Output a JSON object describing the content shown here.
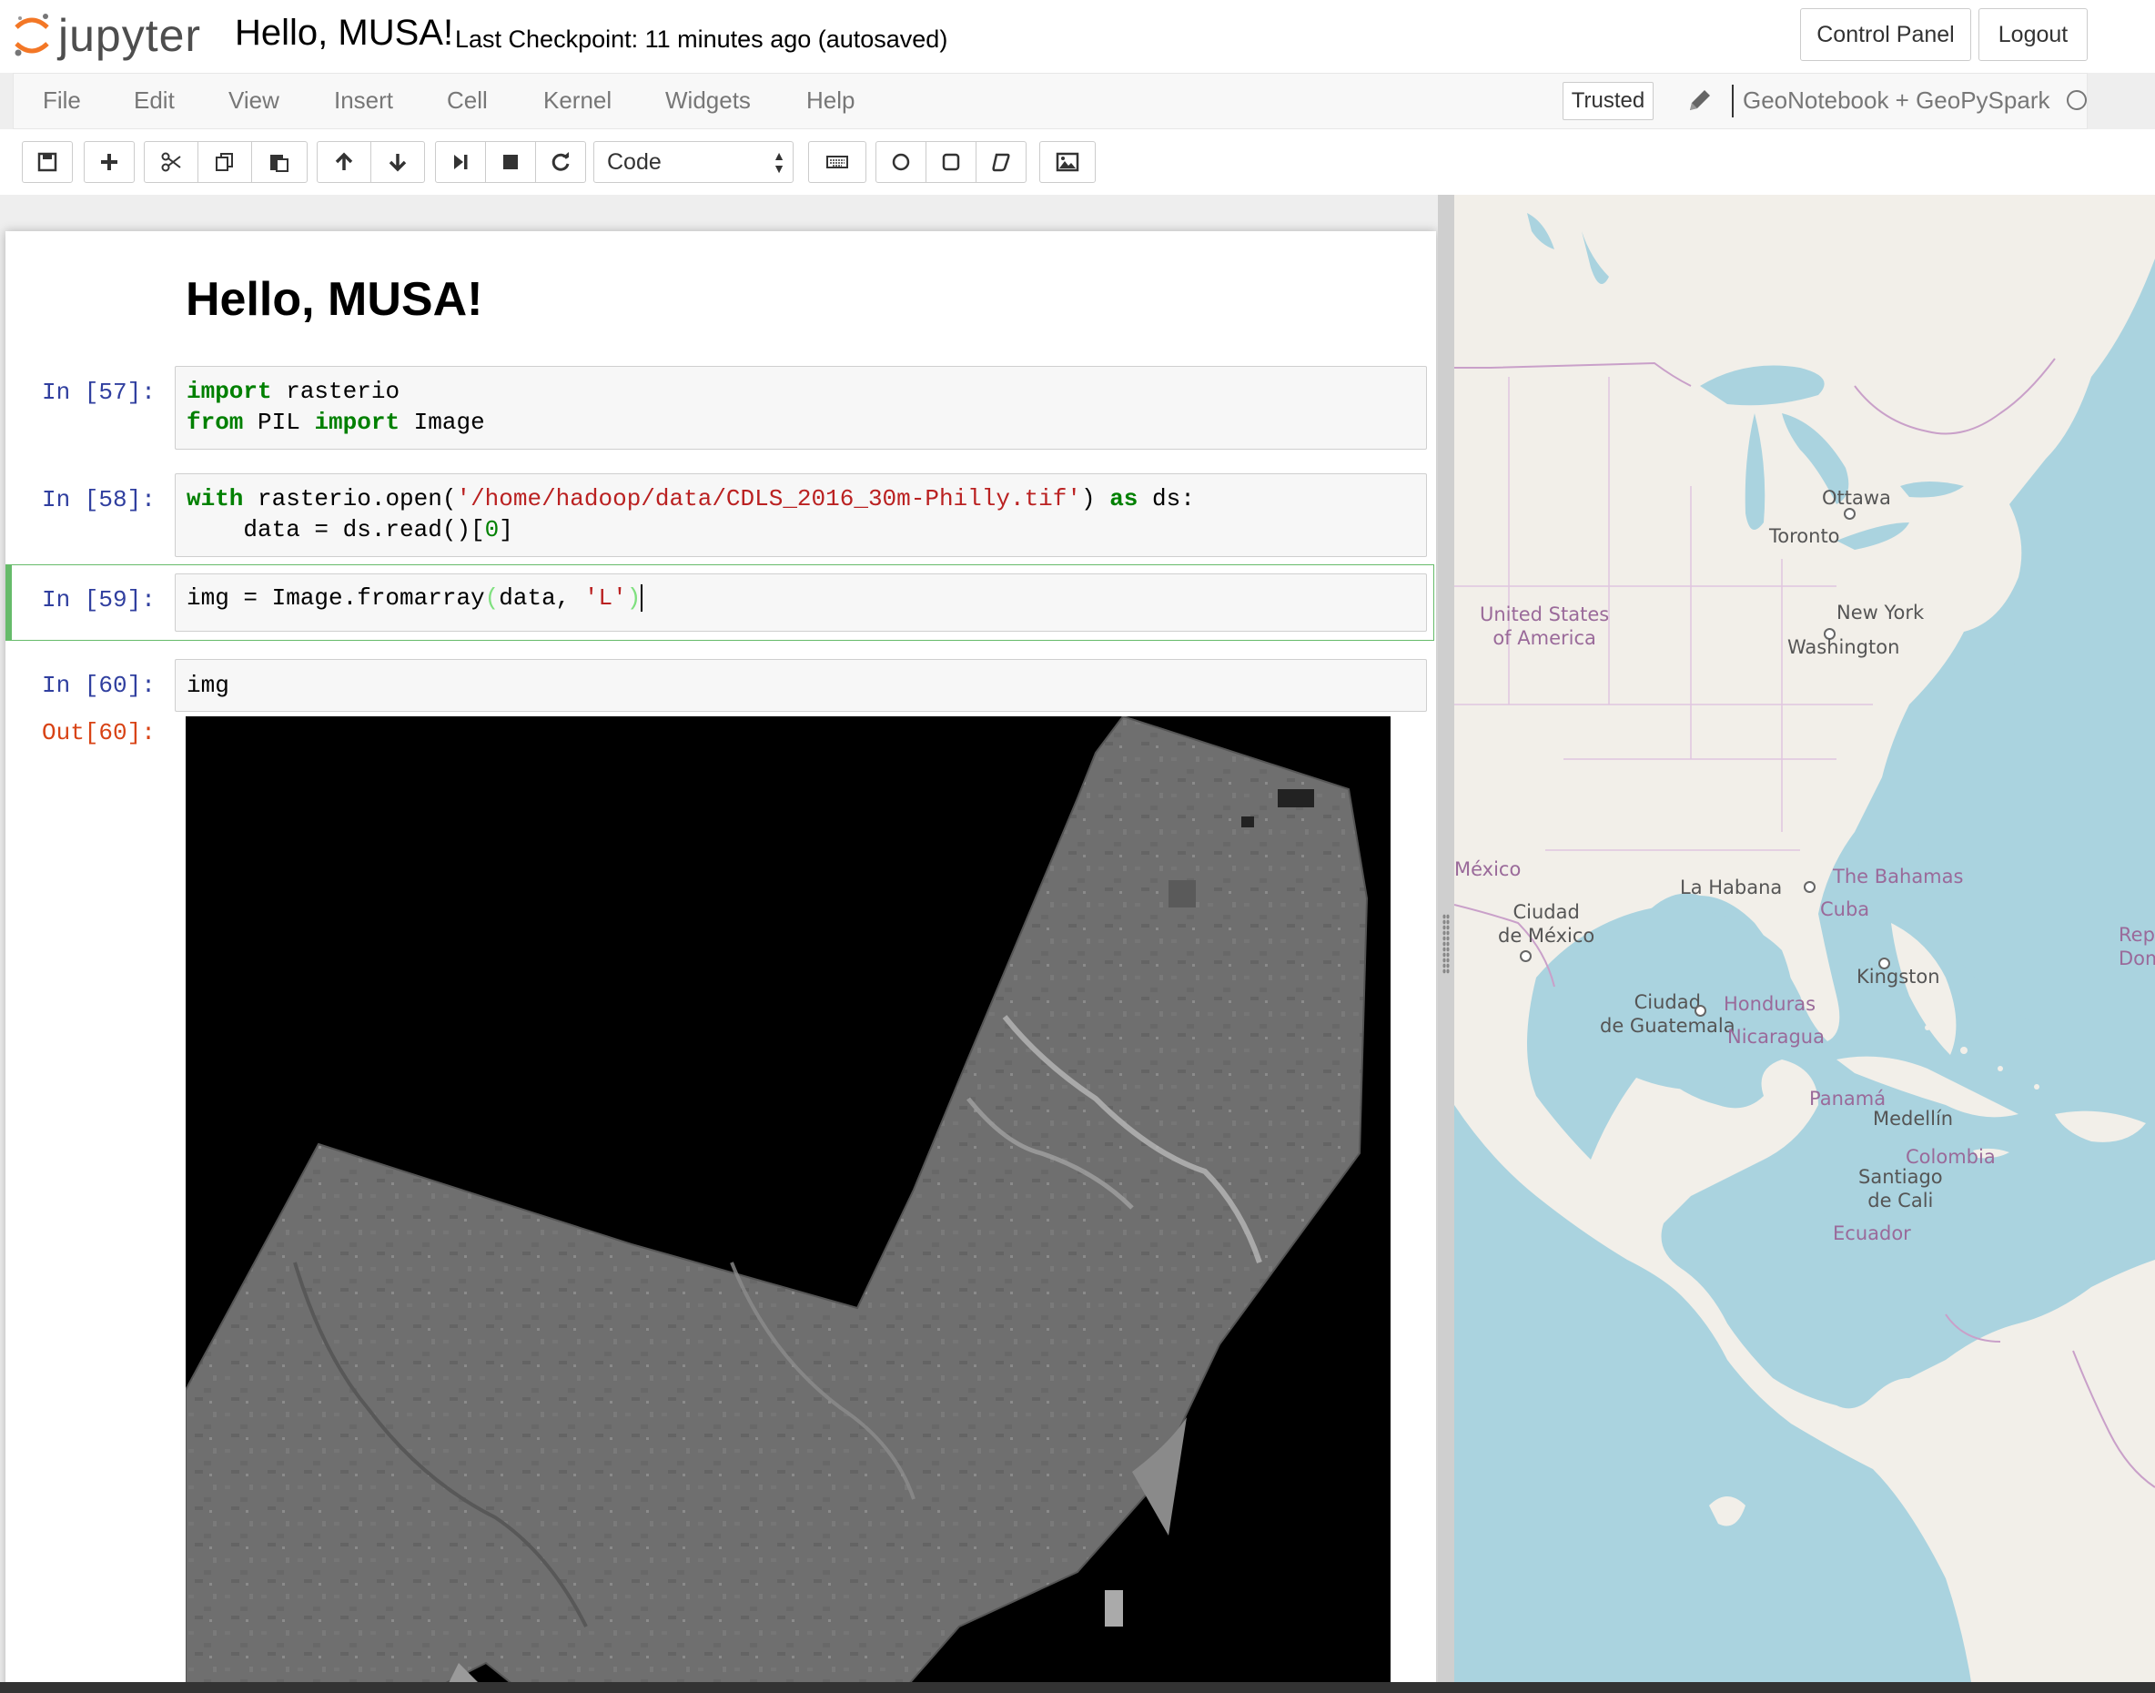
{
  "header": {
    "logo_text": "jupyter",
    "notebook_name": "Hello, MUSA!",
    "checkpoint": "Last Checkpoint: 11 minutes ago (autosaved)",
    "control_panel_label": "Control Panel",
    "logout_label": "Logout"
  },
  "menubar": {
    "items": [
      "File",
      "Edit",
      "View",
      "Insert",
      "Cell",
      "Kernel",
      "Widgets",
      "Help"
    ],
    "trusted_label": "Trusted",
    "kernel_name": "GeoNotebook + GeoPySpark"
  },
  "toolbar": {
    "cell_type": "Code"
  },
  "notebook": {
    "markdown_title": "Hello, MUSA!",
    "cells": [
      {
        "prompt": "In [57]:",
        "line1_kw1": "import",
        "line1_rest": " rasterio",
        "line2_kw1": "from",
        "line2_mid": " PIL ",
        "line2_kw2": "import",
        "line2_rest": " Image"
      },
      {
        "prompt": "In [58]:",
        "kw_with": "with",
        "code_a": " rasterio.open(",
        "str_path": "'/home/hadoop/data/CDLS_2016_30m-Philly.tif'",
        "code_b": ") ",
        "kw_as": "as",
        "code_c": " ds:",
        "line2_a": "    data = ds.read()[",
        "line2_num": "0",
        "line2_b": "]"
      },
      {
        "prompt": "In [59]:",
        "code_a": "img = Image.fromarray",
        "par_open": "(",
        "code_b": "data, ",
        "str_l": "'L'",
        "par_close": ")"
      },
      {
        "prompt": "In [60]:",
        "code": "img"
      }
    ],
    "output_prompt": "Out[60]:"
  },
  "map": {
    "labels": {
      "usa": "United States\nof America",
      "ottawa": "Ottawa",
      "toronto": "Toronto",
      "new_york": "New York",
      "washington": "Washington",
      "mexico": "México",
      "ciudad_mexico": "Ciudad\nde México",
      "la_habana": "La Habana",
      "bahamas": "The Bahamas",
      "cuba": "Cuba",
      "repub": "Repú\nDomi",
      "kingston": "Kingston",
      "guatemala": "Ciudad\nde Guatemala",
      "honduras": "Honduras",
      "nicaragua": "Nicaragua",
      "panama": "Panamá",
      "medellin": "Medellín",
      "colombia": "Colombia",
      "cali": "Santiago\nde Cali",
      "ecuador": "Ecuador"
    }
  },
  "colors": {
    "prompt_in": "#303f9f",
    "prompt_out": "#d84315",
    "keyword": "#008000",
    "string": "#ba2121",
    "selected_cell": "#66bb6a",
    "map_water": "#aad3df",
    "map_land": "#f2efe9"
  }
}
